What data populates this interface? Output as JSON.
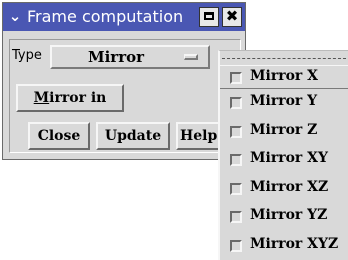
{
  "window": {
    "title": "Frame computation",
    "titlebar_color": "#4a57b3",
    "menu_icon": "chevron-down-icon",
    "min_icon": "square-icon",
    "close_icon": "x-icon"
  },
  "form": {
    "type_label": "Type",
    "type_value": "Mirror",
    "mirror_in_label_prefix": "M",
    "mirror_in_label_rest": "irror in"
  },
  "buttons": {
    "close": "Close",
    "update": "Update",
    "help": "Help"
  },
  "menu": {
    "items": [
      {
        "label": "Mirror X"
      },
      {
        "label": "Mirror Y"
      },
      {
        "label": "Mirror Z"
      },
      {
        "label": "Mirror XY"
      },
      {
        "label": "Mirror XZ"
      },
      {
        "label": "Mirror YZ"
      },
      {
        "label": "Mirror XYZ"
      }
    ]
  }
}
